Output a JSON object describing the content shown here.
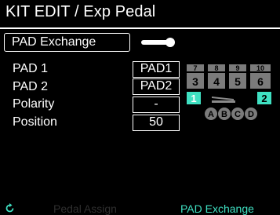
{
  "header": {
    "title": "KIT EDIT / Exp Pedal"
  },
  "pad_exchange": {
    "label": "PAD Exchange"
  },
  "rows": [
    {
      "label": "PAD 1",
      "value": "PAD1"
    },
    {
      "label": "PAD 2",
      "value": "PAD2"
    },
    {
      "label": "Polarity",
      "value": "-"
    },
    {
      "label": "Position",
      "value": "50"
    }
  ],
  "pad_map": {
    "top_row": [
      "7",
      "8",
      "9",
      "10"
    ],
    "mid_row": [
      "3",
      "4",
      "5",
      "6"
    ],
    "bottom_left": "1",
    "bottom_right": "2",
    "letters": [
      "A",
      "B",
      "C",
      "D"
    ],
    "accent": "#3fe0c2"
  },
  "footer": {
    "left_label": "Pedal Assign",
    "right_label": "PAD Exchange"
  }
}
